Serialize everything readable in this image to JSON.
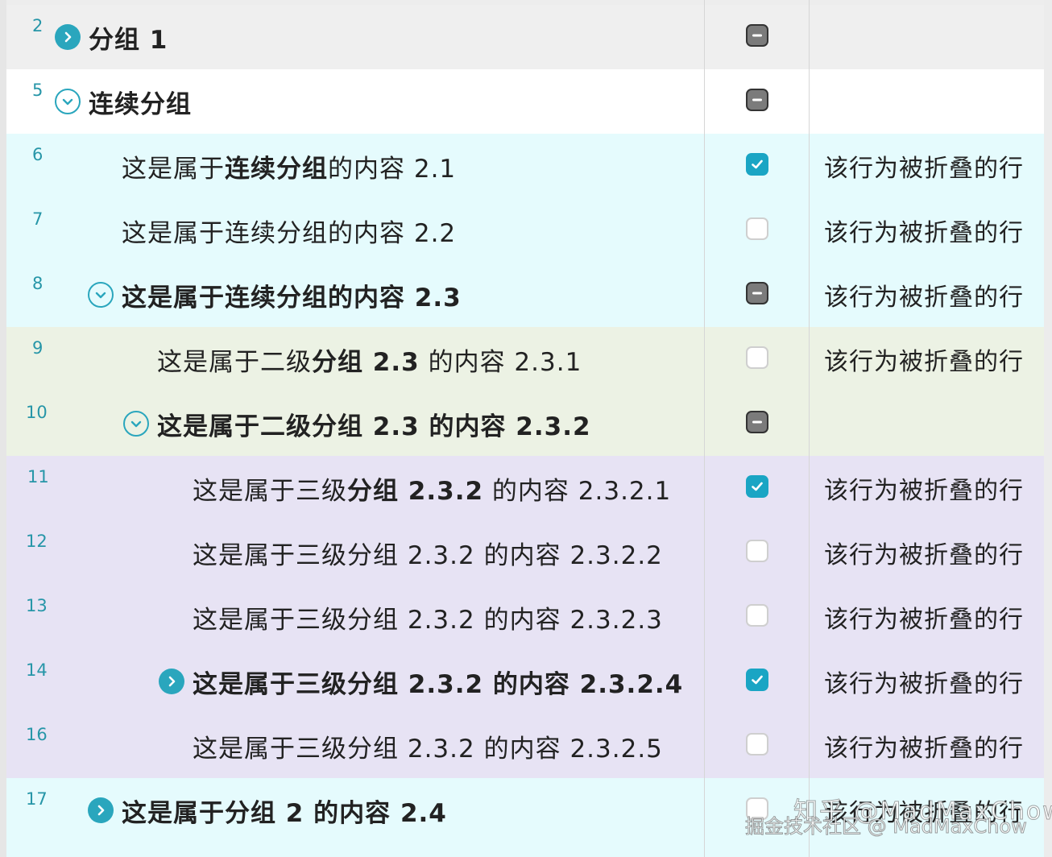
{
  "colors": {
    "accent": "#2aa6bd",
    "checked": "#1aa5c4",
    "header_bg": "#efefef",
    "cyan_bg": "#e5fbfd",
    "green_bg": "#ecf2e4",
    "purple_bg": "#e7e3f4"
  },
  "rows": [
    {
      "num": "2",
      "title": "分组 1",
      "bold": true,
      "toggle": "closed",
      "check": "mixed",
      "note": ""
    },
    {
      "num": "5",
      "title": "连续分组",
      "bold": true,
      "toggle": "open",
      "check": "mixed",
      "note": ""
    },
    {
      "num": "6",
      "title_parts": [
        "这是属于",
        "连续分组",
        "的内容 2.1"
      ],
      "toggle": "none",
      "check": "checked",
      "note": "该行为被折叠的行"
    },
    {
      "num": "7",
      "title": "这是属于连续分组的内容 2.2",
      "bold": false,
      "toggle": "none",
      "check": "empty",
      "note": "该行为被折叠的行"
    },
    {
      "num": "8",
      "title": "这是属于连续分组的内容 2.3",
      "bold": true,
      "toggle": "open",
      "check": "mixed",
      "note": "该行为被折叠的行"
    },
    {
      "num": "9",
      "title_parts": [
        "这是属于二级",
        "分组 2.3",
        "的内容 2.3.1"
      ],
      "toggle": "none",
      "check": "empty",
      "note": "该行为被折叠的行"
    },
    {
      "num": "10",
      "title": "这是属于二级分组 2.3 的内容 2.3.2",
      "bold": true,
      "toggle": "open",
      "check": "mixed",
      "note": ""
    },
    {
      "num": "11",
      "title_parts": [
        "这是属于三级",
        "分组 2.3.2",
        "的内容 2.3.2.1"
      ],
      "toggle": "none",
      "check": "checked",
      "note": "该行为被折叠的行"
    },
    {
      "num": "12",
      "title": "这是属于三级分组 2.3.2 的内容 2.3.2.2",
      "bold": false,
      "toggle": "none",
      "check": "empty",
      "note": "该行为被折叠的行"
    },
    {
      "num": "13",
      "title": "这是属于三级分组 2.3.2 的内容 2.3.2.3",
      "bold": false,
      "toggle": "none",
      "check": "empty",
      "note": "该行为被折叠的行"
    },
    {
      "num": "14",
      "title": "这是属于三级分组 2.3.2 的内容 2.3.2.4",
      "bold": true,
      "toggle": "closed",
      "check": "checked",
      "note": "该行为被折叠的行"
    },
    {
      "num": "16",
      "title": "这是属于三级分组 2.3.2 的内容 2.3.2.5",
      "bold": false,
      "toggle": "none",
      "check": "empty",
      "note": "该行为被折叠的行"
    },
    {
      "num": "17",
      "title": "这是属于分组 2 的内容 2.4",
      "bold": true,
      "toggle": "closed",
      "check": "empty",
      "note": "该行为被折叠的行"
    }
  ],
  "watermark": {
    "line1": "知乎 @MadMaxChow",
    "line2": "掘金技术社区 @ MadMaxChow"
  }
}
